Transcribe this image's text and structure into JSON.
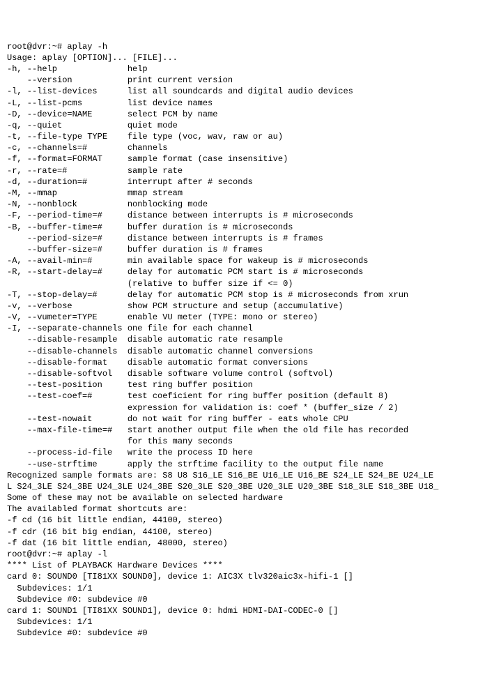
{
  "lines": [
    "root@dvr:~# aplay -h",
    "Usage: aplay [OPTION]... [FILE]...",
    "",
    "-h, --help              help",
    "    --version           print current version",
    "-l, --list-devices      list all soundcards and digital audio devices",
    "-L, --list-pcms         list device names",
    "-D, --device=NAME       select PCM by name",
    "-q, --quiet             quiet mode",
    "-t, --file-type TYPE    file type (voc, wav, raw or au)",
    "-c, --channels=#        channels",
    "-f, --format=FORMAT     sample format (case insensitive)",
    "-r, --rate=#            sample rate",
    "-d, --duration=#        interrupt after # seconds",
    "-M, --mmap              mmap stream",
    "-N, --nonblock          nonblocking mode",
    "-F, --period-time=#     distance between interrupts is # microseconds",
    "-B, --buffer-time=#     buffer duration is # microseconds",
    "    --period-size=#     distance between interrupts is # frames",
    "    --buffer-size=#     buffer duration is # frames",
    "-A, --avail-min=#       min available space for wakeup is # microseconds",
    "-R, --start-delay=#     delay for automatic PCM start is # microseconds",
    "                        (relative to buffer size if <= 0)",
    "-T, --stop-delay=#      delay for automatic PCM stop is # microseconds from xrun",
    "-v, --verbose           show PCM structure and setup (accumulative)",
    "-V, --vumeter=TYPE      enable VU meter (TYPE: mono or stereo)",
    "-I, --separate-channels one file for each channel",
    "    --disable-resample  disable automatic rate resample",
    "    --disable-channels  disable automatic channel conversions",
    "    --disable-format    disable automatic format conversions",
    "    --disable-softvol   disable software volume control (softvol)",
    "    --test-position     test ring buffer position",
    "    --test-coef=#       test coeficient for ring buffer position (default 8)",
    "                        expression for validation is: coef * (buffer_size / 2)",
    "    --test-nowait       do not wait for ring buffer - eats whole CPU",
    "    --max-file-time=#   start another output file when the old file has recorded",
    "                        for this many seconds",
    "    --process-id-file   write the process ID here",
    "    --use-strftime      apply the strftime facility to the output file name",
    "Recognized sample formats are: S8 U8 S16_LE S16_BE U16_LE U16_BE S24_LE S24_BE U24_LE",
    "L S24_3LE S24_3BE U24_3LE U24_3BE S20_3LE S20_3BE U20_3LE U20_3BE S18_3LE S18_3BE U18_",
    "Some of these may not be available on selected hardware",
    "The availabled format shortcuts are:",
    "-f cd (16 bit little endian, 44100, stereo)",
    "-f cdr (16 bit big endian, 44100, stereo)",
    "-f dat (16 bit little endian, 48000, stereo)",
    "root@dvr:~# aplay -l",
    "**** List of PLAYBACK Hardware Devices ****",
    "card 0: SOUND0 [TI81XX SOUND0], device 1: AIC3X tlv320aic3x-hifi-1 []",
    "  Subdevices: 1/1",
    "  Subdevice #0: subdevice #0",
    "card 1: SOUND1 [TI81XX SOUND1], device 0: hdmi HDMI-DAI-CODEC-0 []",
    "  Subdevices: 1/1",
    "  Subdevice #0: subdevice #0"
  ]
}
